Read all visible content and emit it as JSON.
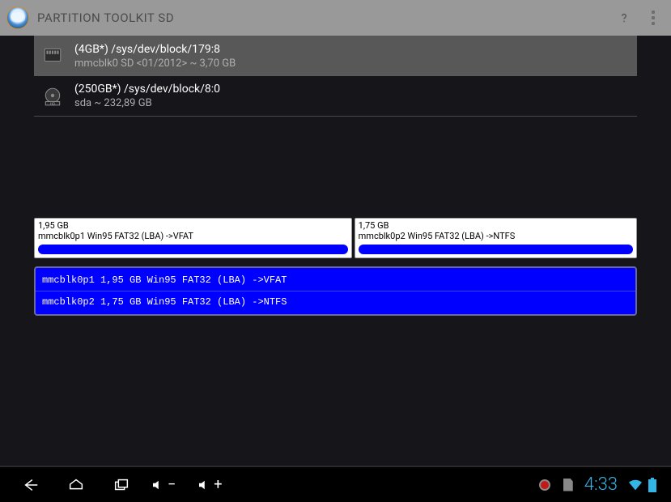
{
  "app": {
    "title": "PARTITION TOOLKIT SD"
  },
  "devices": [
    {
      "title": "(4GB*) /sys/dev/block/179:8",
      "subtitle": "mmcblk0 SD <01/2012>  ~ 3,70 GB",
      "selected": true,
      "icon": "sd"
    },
    {
      "title": "(250GB*) /sys/dev/block/8:0",
      "subtitle": "sda  ~ 232,89 GB",
      "selected": false,
      "icon": "hd"
    }
  ],
  "partition_map": [
    {
      "size_label": "1,95 GB",
      "desc": "mmcblk0p1 Win95 FAT32 (LBA) ->VFAT",
      "width_pct": 53
    },
    {
      "size_label": "1,75 GB",
      "desc": "mmcblk0p2 Win95 FAT32 (LBA) ->NTFS",
      "width_pct": 47
    }
  ],
  "partition_rows": [
    "mmcblk0p1 1,95 GB Win95 FAT32 (LBA) ->VFAT",
    "mmcblk0p2 1,75 GB Win95 FAT32 (LBA) ->NTFS"
  ],
  "status": {
    "time": "4:33",
    "ampm": ""
  }
}
